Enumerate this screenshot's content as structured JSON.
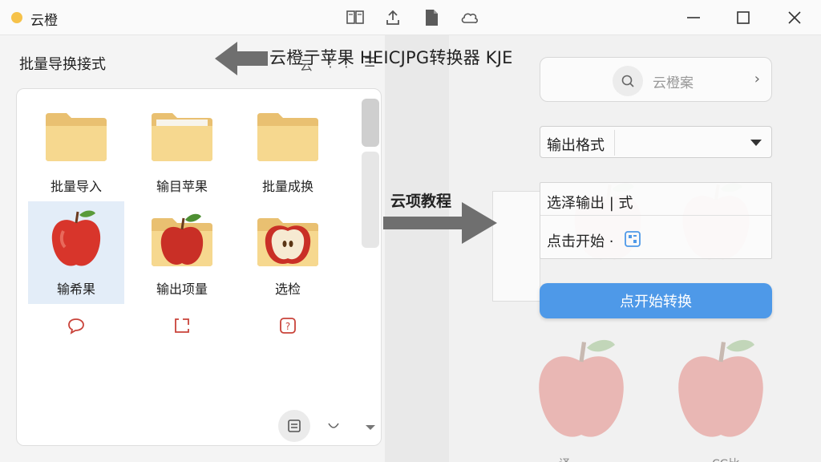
{
  "window": {
    "title": "云橙",
    "toolbar_icons": [
      "book-icon",
      "upload-icon",
      "document-icon",
      "cloud-icon"
    ],
    "controls": [
      "minimize-icon",
      "maximize-icon",
      "close-icon"
    ]
  },
  "left_panel": {
    "title": "批量导换接式",
    "header_glyphs": [
      "云",
      "⋮",
      "⋮",
      "☰"
    ],
    "tiles": [
      {
        "label": "批量导入",
        "thumb": "folder-icon"
      },
      {
        "label": "输目苹果",
        "thumb": "folder-icon"
      },
      {
        "label": "批量成换",
        "thumb": "folder-icon"
      },
      {
        "label": "输希果",
        "thumb": "apple-icon",
        "selected": true
      },
      {
        "label": "输出项量",
        "thumb": "folder-apple-icon"
      },
      {
        "label": "选检",
        "thumb": "folder-apple-half-icon"
      }
    ],
    "small_icons": [
      "chat-bubble-icon",
      "export-icon",
      "help-icon"
    ],
    "bottom_controls": [
      "convert-icon",
      "chevron-down-icon"
    ]
  },
  "right_panel": {
    "search": {
      "text": "云橙案",
      "chevron": "›"
    },
    "format_select": {
      "label": "输出格式"
    },
    "output_card": {
      "row1": "选泽输出 | 式",
      "row2": "点击开始 ·"
    },
    "start_button": {
      "label": "点开始转换"
    },
    "bottom_texts": [
      "-译",
      "CG比"
    ]
  },
  "overlay": {
    "title": "云橙亍苹果 HEICJPG转换器 KJE",
    "tutorial_label": "云项教程"
  },
  "colors": {
    "accent": "#4e99e8",
    "arrow": "#6f6f6f",
    "folder": "#f3d48c",
    "apple_red": "#d8352b",
    "icon_red": "#c9433a"
  }
}
